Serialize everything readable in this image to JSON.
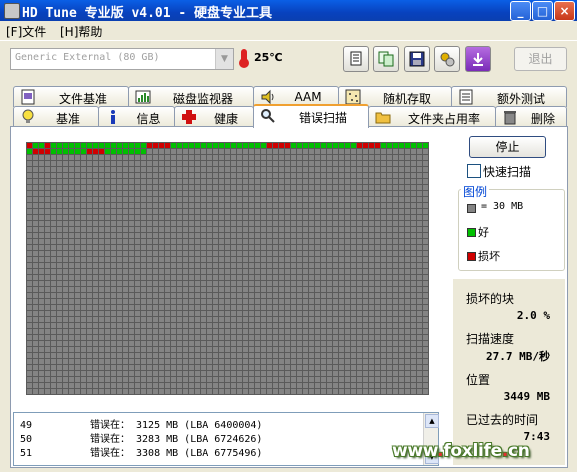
{
  "window": {
    "title": "HD Tune 专业版 v4.01 - 硬盘专业工具"
  },
  "menu": [
    {
      "label": "[F]文件"
    },
    {
      "label": "[H]帮助"
    }
  ],
  "toolbar": {
    "drive": "Generic External     (80 GB)",
    "temperature": "25℃",
    "exit_label": "退出",
    "buttons": [
      "copy-text-icon",
      "copy-screen-icon",
      "save-icon",
      "options-icon",
      "download-icon"
    ]
  },
  "tabs_top": [
    "文件基准",
    "磁盘监视器",
    "AAM",
    "随机存取",
    "额外测试"
  ],
  "tabs_bottom": [
    "基准",
    "信息",
    "健康",
    "错误扫描",
    "文件夹占用率",
    "删除"
  ],
  "active_tab": "错误扫描",
  "scan": {
    "stop_label": "停止",
    "quick_scan_label": "快速扫描",
    "quick_scan_checked": false,
    "legend": {
      "title": "图例",
      "block_size": "= 30 MB",
      "good": "好",
      "bad": "损坏"
    },
    "stats": {
      "bad_blocks_label": "损坏的块",
      "bad_blocks_value": "2.0 %",
      "scan_speed_label": "扫描速度",
      "scan_speed_value": "27.7 MB/秒",
      "position_label": "位置",
      "position_value": "3449 MB",
      "elapsed_label": "已过去的时间",
      "elapsed_value": "7:43"
    },
    "grid": {
      "columns": 67,
      "rows": 42,
      "colors": {
        "unscanned": "#848484",
        "good": "#00C000",
        "bad": "#D00000"
      },
      "row0": "BGGBGGGGGGGGGGGGGGGGBBBBGGGGGGGGGGGGGGGGBBBBGGGGGGGGGGGBBBBGGGGGGGG",
      "row1": "GBBBGGGGGGBBBGGGGGGGGGGGGGGGGGGGGGGGGGGGGGGGGGGGGGGGGGGGGGGGGGGGGGG",
      "row1_filled": 20
    },
    "log": [
      {
        "n": "49",
        "text": "错误在： 3125 MB (LBA 6400004)"
      },
      {
        "n": "50",
        "text": "错误在： 3283 MB (LBA 6724626)"
      },
      {
        "n": "51",
        "text": "错误在： 3308 MB (LBA 6775496)"
      }
    ]
  },
  "watermark": {
    "pre": "www",
    "site": "foxlife",
    "tld": "cn"
  }
}
